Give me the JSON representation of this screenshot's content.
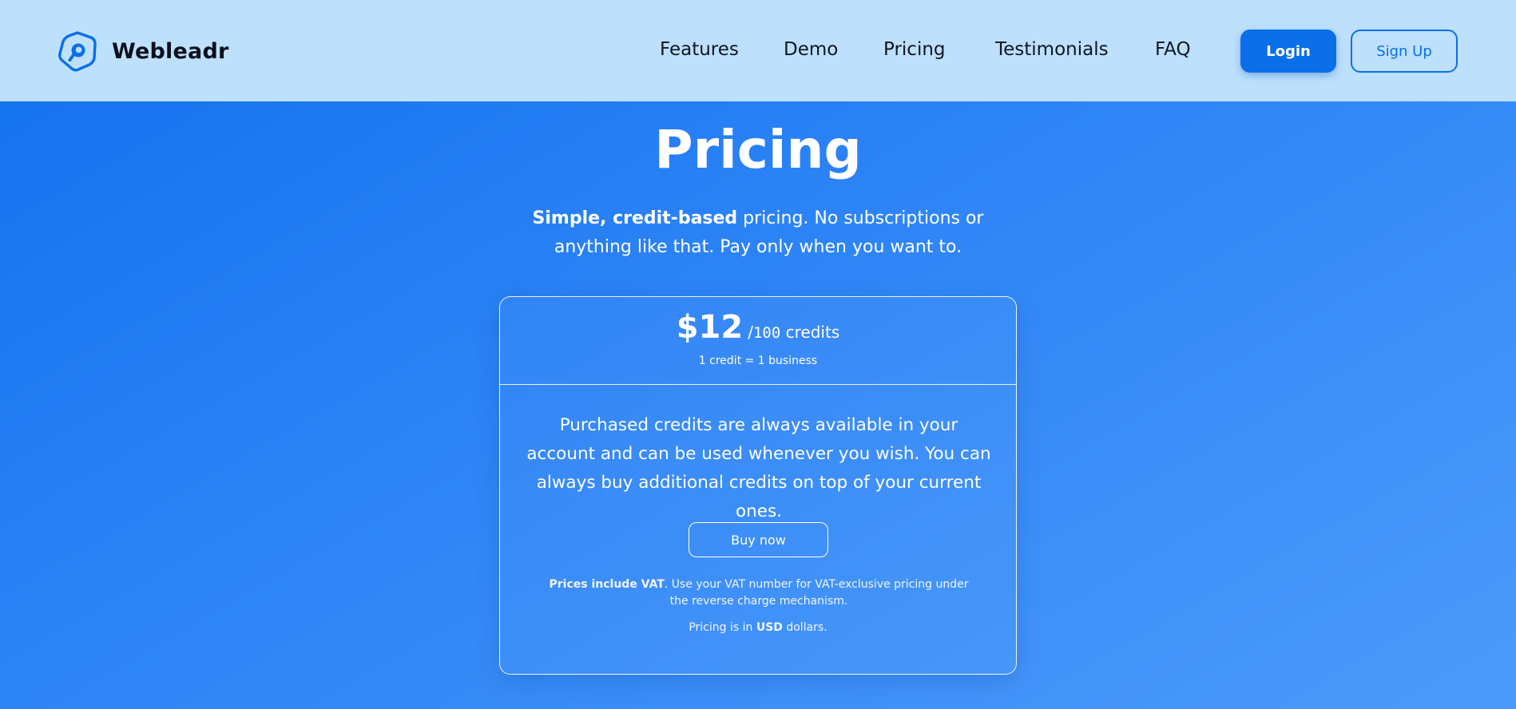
{
  "header": {
    "brand": "Webleadr",
    "nav": [
      {
        "label": "Features"
      },
      {
        "label": "Demo"
      },
      {
        "label": "Pricing"
      },
      {
        "label": "Testimonials"
      },
      {
        "label": "FAQ"
      }
    ],
    "login_label": "Login",
    "signup_label": "Sign Up"
  },
  "hero": {
    "title": "Pricing",
    "subtitle_bold": "Simple, credit-based",
    "subtitle_rest": " pricing. No subscriptions or anything like that. Pay only when you want to."
  },
  "card": {
    "price": "$12",
    "unit_prefix": "/",
    "unit_number": "100",
    "unit_suffix": " credits",
    "credit_note": "1 credit = 1 business",
    "description": "Purchased credits are always available in your account and can be used whenever you wish. You can always buy additional credits on top of your current ones.",
    "buy_label": "Buy now",
    "vat_bold": "Prices include VAT",
    "vat_rest": ". Use your VAT number for VAT-exclusive pricing under the reverse charge mechanism.",
    "currency_prefix": "Pricing is in ",
    "currency_bold": "USD",
    "currency_suffix": " dollars."
  },
  "colors": {
    "header_bg": "#bde0fd",
    "accent": "#0a6fe8",
    "gradient_start": "#1270ee",
    "gradient_end": "#4c9bfb"
  },
  "icons": {
    "logo": "location-pin-hexagon-icon"
  }
}
